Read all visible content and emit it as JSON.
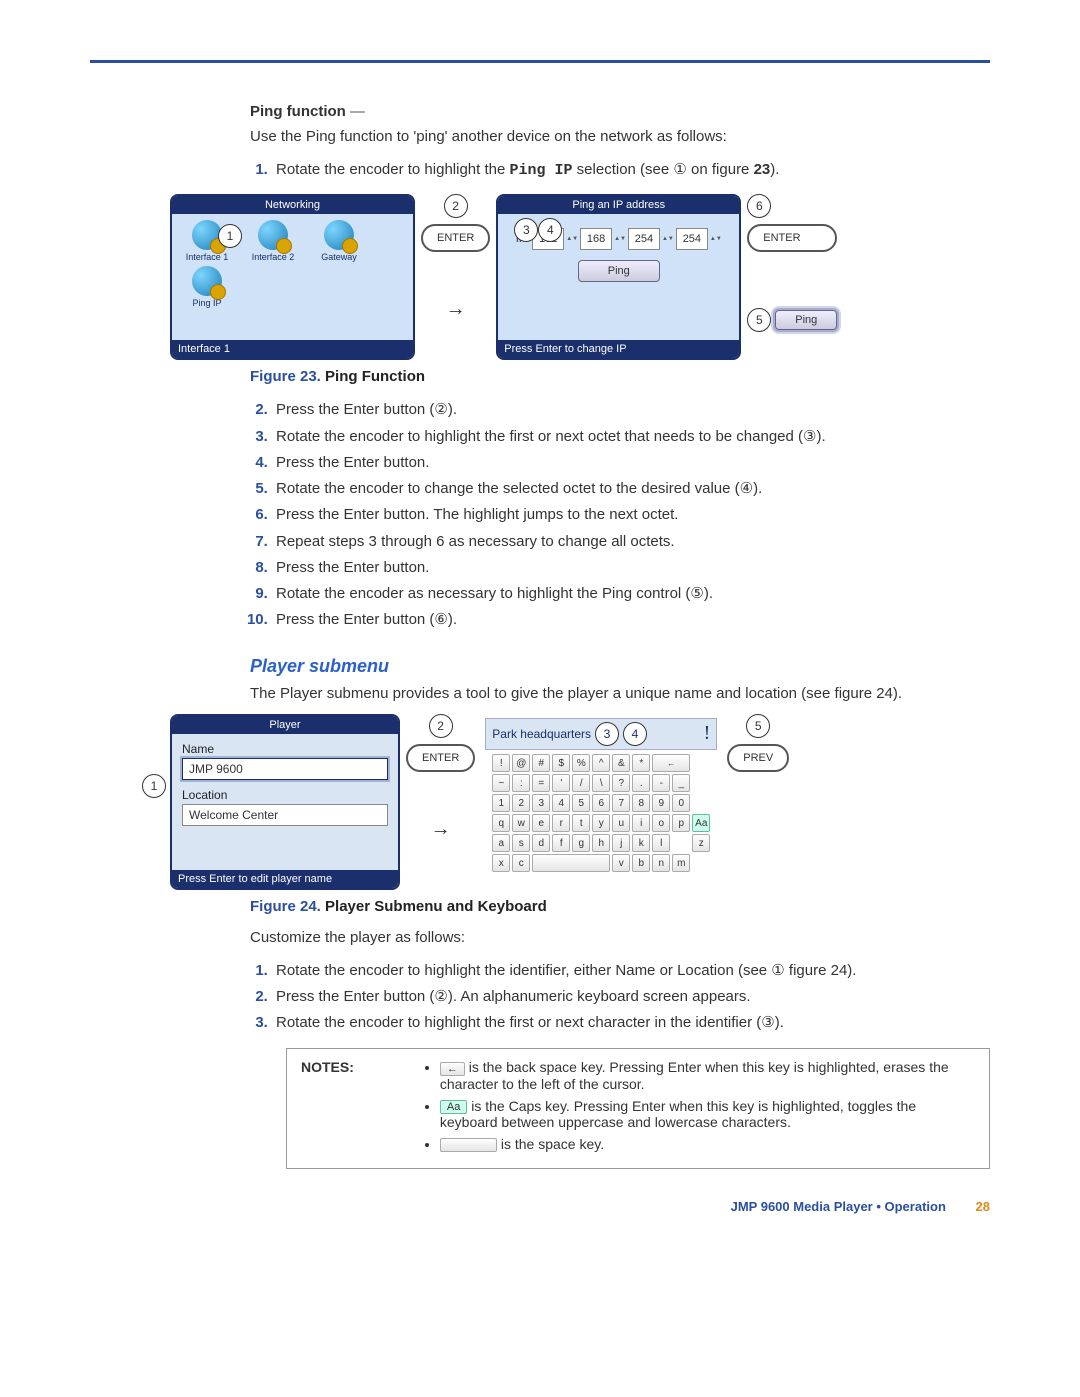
{
  "header": {
    "section_title": "Ping function",
    "dash": " —"
  },
  "intro": "Use the Ping function to 'ping' another device on the network as follows:",
  "steps1": {
    "s1_pre": "Rotate the encoder to highlight the ",
    "s1_code": "Ping IP",
    "s1_post": " selection (see ",
    "s1_ref": "①",
    "s1_end": " on figure ",
    "s1_fig": "23",
    "s1_close": ")."
  },
  "figure23": {
    "screen1_title": "Networking",
    "icons": [
      "Interface 1",
      "Interface 2",
      "Gateway",
      "Ping IP"
    ],
    "footer1": "Interface 1",
    "enter_btn": "ENTER",
    "screen2_title": "Ping an IP address",
    "ip_label": "IP",
    "octets": [
      "192",
      "168",
      "254",
      "254"
    ],
    "ping_label": "Ping",
    "footer2": "Press Enter to change IP",
    "annot2": "2",
    "annot3": "3",
    "annot4": "4",
    "annot5": "5",
    "annot6": "6",
    "annot1": "1",
    "caption_num": "Figure 23. ",
    "caption_text": "Ping Function"
  },
  "steps2": [
    "Press the Enter button (②).",
    "Rotate the encoder to highlight the first or next octet that needs to be changed (③).",
    "Press the Enter button.",
    "Rotate the encoder to change the selected octet to the desired value (④).",
    "Press the Enter button. The highlight jumps to the next octet.",
    "Repeat steps 3 through 6 as necessary to change all octets.",
    "Press the Enter button.",
    "Rotate the encoder as necessary to highlight the Ping control (⑤).",
    "Press the Enter button (⑥)."
  ],
  "player": {
    "heading": "Player submenu",
    "intro": "The Player submenu provides a tool to give the player a unique name and location (see figure 24).",
    "screen_title": "Player",
    "name_label": "Name",
    "name_value": "JMP 9600",
    "location_label": "Location",
    "location_value": "Welcome Center",
    "footer": "Press Enter to edit player name",
    "enter_btn": "ENTER",
    "prev_btn": "PREV",
    "kbd_title": "Park headquarters",
    "cursor": "!",
    "annot1": "1",
    "annot2": "2",
    "annot3": "3",
    "annot4": "4",
    "annot5": "5",
    "caption_num": "Figure 24. ",
    "caption_text": "Player Submenu and Keyboard",
    "keys_row1": [
      "!",
      "@",
      "#",
      "$",
      "%",
      "^",
      "&",
      "*",
      "←"
    ],
    "keys_row2": [
      "~",
      ":",
      "=",
      "'",
      "/",
      "\\",
      "?",
      ".",
      "-",
      "_"
    ],
    "keys_row3": [
      "1",
      "2",
      "3",
      "4",
      "5",
      "6",
      "7",
      "8",
      "9",
      "0"
    ],
    "keys_row4": [
      "q",
      "w",
      "e",
      "r",
      "t",
      "y",
      "u",
      "i",
      "o",
      "p"
    ],
    "keys_row5": [
      "Aa",
      "a",
      "s",
      "d",
      "f",
      "g",
      "h",
      "j",
      "k",
      "l"
    ],
    "keys_row6": [
      "z",
      "x",
      "c",
      "",
      "v",
      "b",
      "n",
      "m"
    ]
  },
  "customize": {
    "intro": "Customize the player as follows:",
    "s1": "Rotate the encoder to highlight the identifier, either Name or Location (see ① figure 24).",
    "s2": "Press the Enter button (②). An alphanumeric keyboard screen appears.",
    "s3": "Rotate the encoder to highlight the first or next character in the identifier (③)."
  },
  "notes": {
    "label": "NOTES:",
    "n1": " is the back space key. Pressing Enter when this key is highlighted, erases the character to the left of the cursor.",
    "n1_key": "←",
    "n2": " is the Caps key. Pressing Enter when this key is highlighted, toggles the keyboard between uppercase and lowercase characters.",
    "n2_key": "Aa",
    "n3": " is the space key."
  },
  "footer": {
    "text": "JMP 9600 Media Player • Operation",
    "page": "28"
  }
}
